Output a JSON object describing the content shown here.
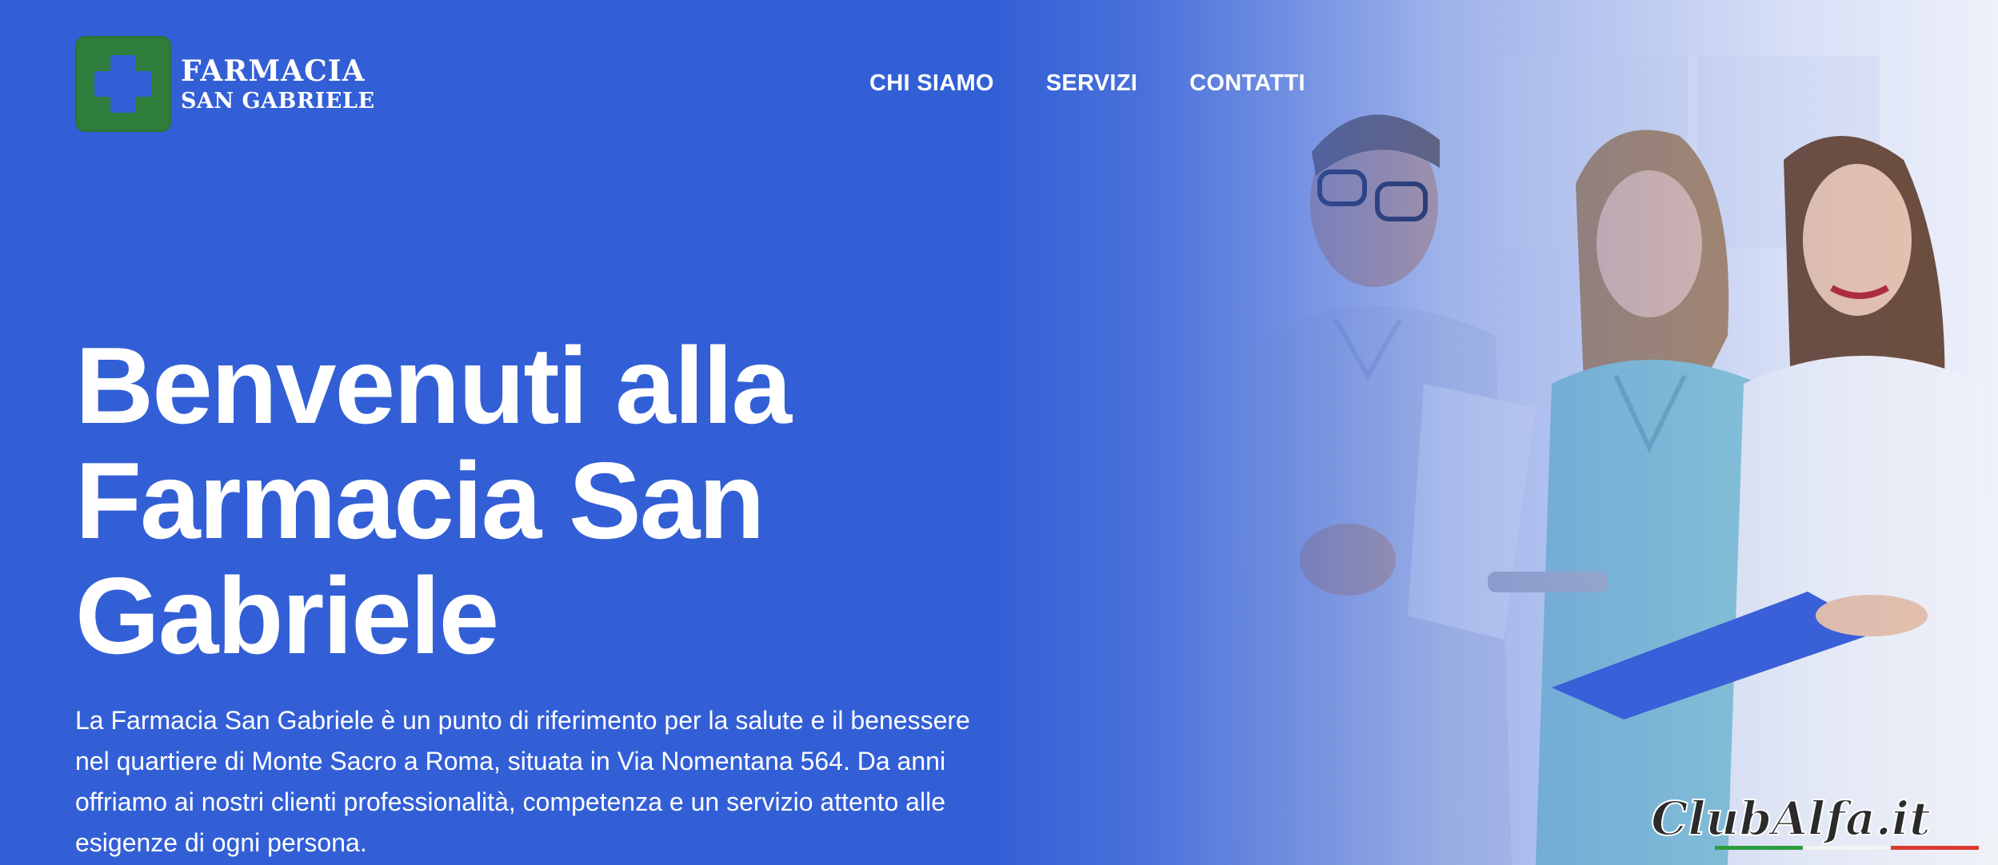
{
  "brand": {
    "line1": "FARMACIA",
    "line2": "SAN GABRIELE",
    "logo_icon": "pharmacy-cross-icon",
    "logo_bg_color": "#2e7d3a"
  },
  "nav": {
    "items": [
      {
        "label": "CHI SIAMO"
      },
      {
        "label": "SERVIZI"
      },
      {
        "label": "CONTATTI"
      }
    ]
  },
  "hero": {
    "title_lines": [
      "Benvenuti alla",
      "Farmacia San",
      "Gabriele"
    ],
    "description": "La Farmacia San Gabriele è un punto di riferimento per la salute e il benessere nel quartiere di Monte Sacro a Roma, situata in Via Nomentana 564. Da anni offriamo ai nostri clienti professionalità, competenza e un servizio attento alle esigenze di ogni persona."
  },
  "watermark": {
    "text": "ClubAlfa.it"
  },
  "colors": {
    "background": "#335fd6",
    "text": "#ffffff",
    "accent_green": "#2e7d3a"
  }
}
